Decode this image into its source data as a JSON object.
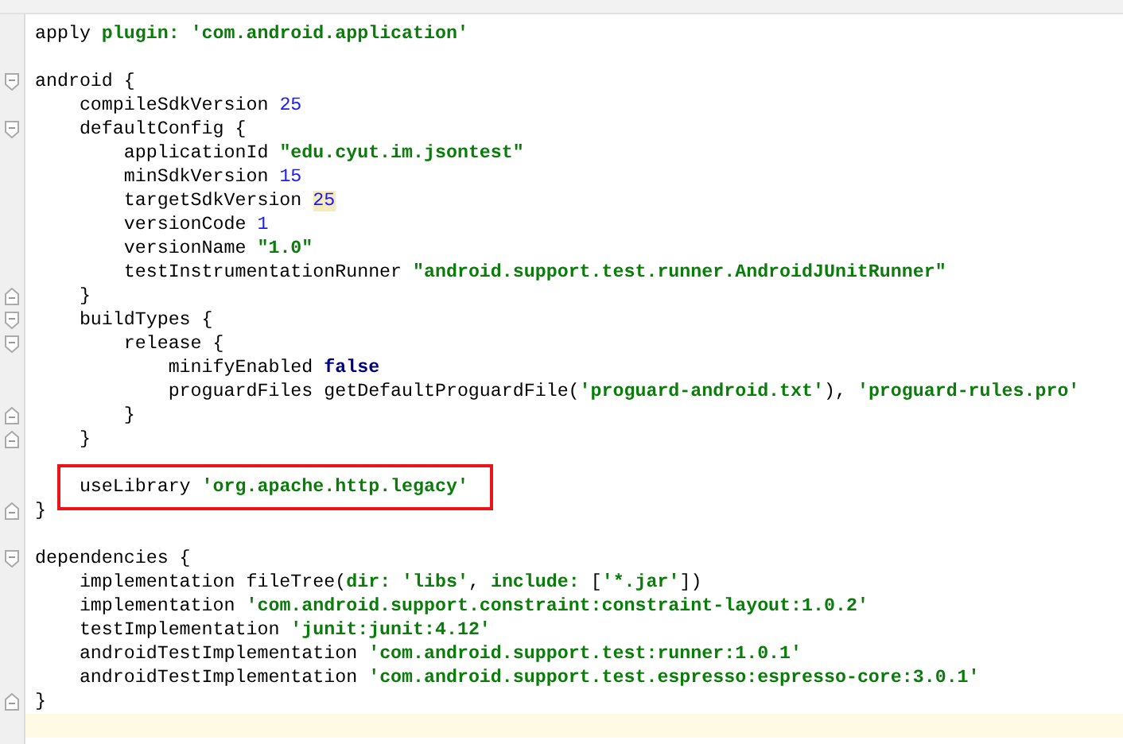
{
  "editor": {
    "lines": [
      {
        "kind": "code",
        "tokens": [
          {
            "kind": "plain",
            "text": "apply "
          },
          {
            "kind": "keyword",
            "text": "plugin: "
          },
          {
            "kind": "string",
            "text": "'com.android.application'"
          }
        ]
      },
      {
        "kind": "blank"
      },
      {
        "kind": "open",
        "tokens": [
          {
            "kind": "plain",
            "text": "android {"
          }
        ]
      },
      {
        "kind": "code",
        "tokens": [
          {
            "kind": "plain",
            "text": "    compileSdkVersion "
          },
          {
            "kind": "number",
            "text": "25"
          }
        ]
      },
      {
        "kind": "open",
        "tokens": [
          {
            "kind": "plain",
            "text": "    defaultConfig {"
          }
        ]
      },
      {
        "kind": "code",
        "tokens": [
          {
            "kind": "plain",
            "text": "        applicationId "
          },
          {
            "kind": "string",
            "text": "\"edu.cyut.im.jsontest\""
          }
        ]
      },
      {
        "kind": "code",
        "tokens": [
          {
            "kind": "plain",
            "text": "        minSdkVersion "
          },
          {
            "kind": "number",
            "text": "15"
          }
        ]
      },
      {
        "kind": "code",
        "tokens": [
          {
            "kind": "plain",
            "text": "        targetSdkVersion "
          },
          {
            "kind": "number",
            "text": "25",
            "highlighted": true
          }
        ]
      },
      {
        "kind": "code",
        "tokens": [
          {
            "kind": "plain",
            "text": "        versionCode "
          },
          {
            "kind": "number",
            "text": "1"
          }
        ]
      },
      {
        "kind": "code",
        "tokens": [
          {
            "kind": "plain",
            "text": "        versionName "
          },
          {
            "kind": "string",
            "text": "\"1.0\""
          }
        ]
      },
      {
        "kind": "code",
        "tokens": [
          {
            "kind": "plain",
            "text": "        testInstrumentationRunner "
          },
          {
            "kind": "string",
            "text": "\"android.support.test.runner.AndroidJUnitRunner\""
          }
        ]
      },
      {
        "kind": "close",
        "tokens": [
          {
            "kind": "plain",
            "text": "    }"
          }
        ]
      },
      {
        "kind": "open",
        "tokens": [
          {
            "kind": "plain",
            "text": "    buildTypes {"
          }
        ]
      },
      {
        "kind": "open",
        "tokens": [
          {
            "kind": "plain",
            "text": "        release {"
          }
        ]
      },
      {
        "kind": "code",
        "tokens": [
          {
            "kind": "plain",
            "text": "            minifyEnabled "
          },
          {
            "kind": "bool",
            "text": "false"
          }
        ]
      },
      {
        "kind": "code",
        "tokens": [
          {
            "kind": "plain",
            "text": "            proguardFiles getDefaultProguardFile("
          },
          {
            "kind": "string",
            "text": "'proguard-android.txt'"
          },
          {
            "kind": "plain",
            "text": "), "
          },
          {
            "kind": "string",
            "text": "'proguard-rules.pro'"
          }
        ]
      },
      {
        "kind": "close",
        "tokens": [
          {
            "kind": "plain",
            "text": "        }"
          }
        ]
      },
      {
        "kind": "close",
        "tokens": [
          {
            "kind": "plain",
            "text": "    }"
          }
        ]
      },
      {
        "kind": "blank"
      },
      {
        "kind": "code",
        "boxed": true,
        "tokens": [
          {
            "kind": "plain",
            "text": "    useLibrary "
          },
          {
            "kind": "string",
            "text": "'org.apache.http.legacy'"
          }
        ]
      },
      {
        "kind": "close",
        "tokens": [
          {
            "kind": "plain",
            "text": "}"
          }
        ]
      },
      {
        "kind": "blank"
      },
      {
        "kind": "open",
        "tokens": [
          {
            "kind": "plain",
            "text": "dependencies {"
          }
        ]
      },
      {
        "kind": "code",
        "tokens": [
          {
            "kind": "plain",
            "text": "    implementation fileTree("
          },
          {
            "kind": "keyword",
            "text": "dir: "
          },
          {
            "kind": "string",
            "text": "'libs'"
          },
          {
            "kind": "plain",
            "text": ", "
          },
          {
            "kind": "keyword",
            "text": "include:"
          },
          {
            "kind": "plain",
            "text": " ["
          },
          {
            "kind": "string",
            "text": "'*.jar'"
          },
          {
            "kind": "plain",
            "text": "])"
          }
        ]
      },
      {
        "kind": "code",
        "tokens": [
          {
            "kind": "plain",
            "text": "    implementation "
          },
          {
            "kind": "string",
            "text": "'com.android.support.constraint:constraint-layout:1.0.2'"
          }
        ]
      },
      {
        "kind": "code",
        "tokens": [
          {
            "kind": "plain",
            "text": "    testImplementation "
          },
          {
            "kind": "string",
            "text": "'junit:junit:4.12'"
          }
        ]
      },
      {
        "kind": "code",
        "tokens": [
          {
            "kind": "plain",
            "text": "    androidTestImplementation "
          },
          {
            "kind": "string",
            "text": "'com.android.support.test:runner:1.0.1'"
          }
        ]
      },
      {
        "kind": "code",
        "tokens": [
          {
            "kind": "plain",
            "text": "    androidTestImplementation "
          },
          {
            "kind": "string",
            "text": "'com.android.support.test.espresso:espresso-core:3.0.1'"
          }
        ]
      },
      {
        "kind": "close",
        "tokens": [
          {
            "kind": "plain",
            "text": "}"
          }
        ]
      },
      {
        "kind": "blank",
        "current": true
      }
    ]
  }
}
